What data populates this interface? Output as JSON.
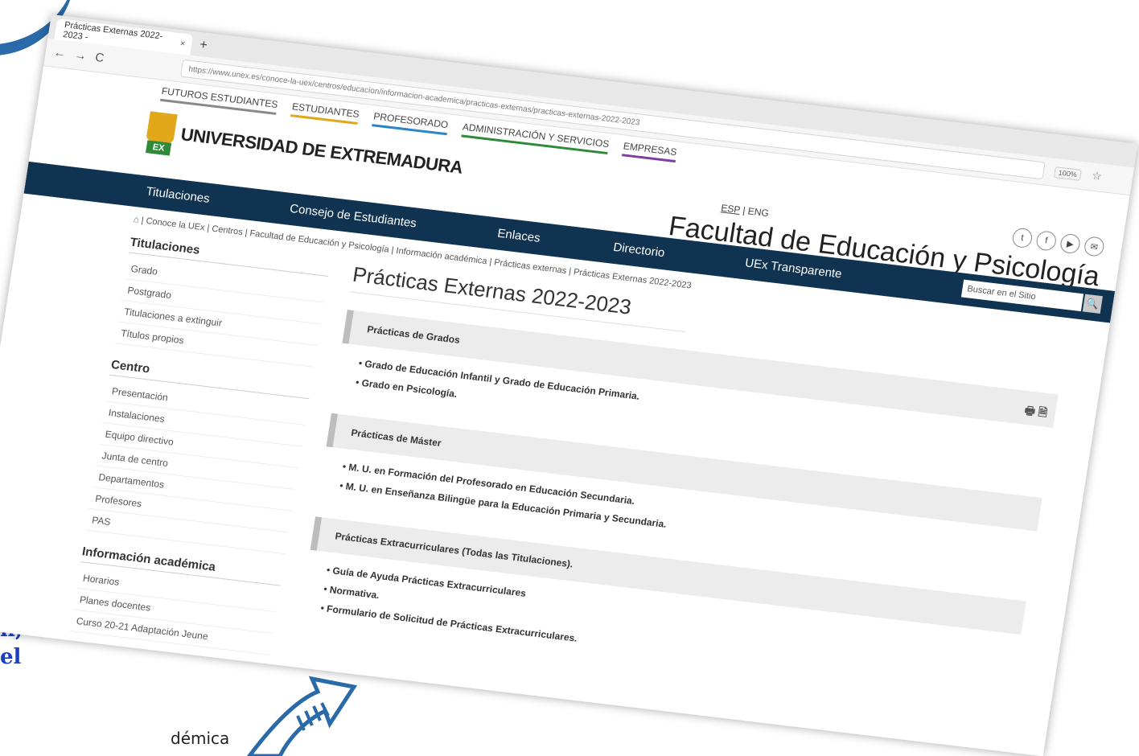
{
  "browser": {
    "tab_title": "Prácticas Externas 2022-2023 -",
    "tab_close": "×",
    "new_tab": "+",
    "back": "←",
    "forward": "→",
    "reload": "C",
    "url_text": "https://www.unex.es/conoce-la-uex/centros/educacion/informacion-academica/practicas-externas/practicas-externas-2022-2023",
    "zoom": "100%",
    "star": "☆"
  },
  "site": {
    "audience_nav": [
      "FUTUROS ESTUDIANTES",
      "ESTUDIANTES",
      "PROFESORADO",
      "ADMINISTRACIÓN Y SERVICIOS",
      "EMPRESAS"
    ],
    "audience_colors": [
      "#888888",
      "#e0a81a",
      "#2a86c8",
      "#2f8a3a",
      "#7b3fa0"
    ],
    "logo_ex": "EX",
    "logo_text": "UNIVERSIDAD DE EXTREMADURA",
    "lang_esp": "ESP",
    "lang_sep": "|",
    "lang_eng": "ENG",
    "social": [
      "t",
      "f",
      "▶",
      "✉"
    ],
    "faculty": "Facultad de Educación y Psicología",
    "main_nav": [
      "Titulaciones",
      "Consejo de Estudiantes",
      "Enlaces",
      "Directorio",
      "UEx Transparente"
    ],
    "search_placeholder": "Buscar en el Sitio",
    "search_button": "🔍",
    "nav_color": "#0f3350"
  },
  "breadcrumb": "⌂  |  Conoce la UEx  |  Centros  |  Facultad de Educación y Psicología  |  Información académica  |  Prácticas externas  |  Prácticas Externas 2022-2023",
  "sidebar": {
    "groups": [
      {
        "title": "Titulaciones",
        "items": [
          "Grado",
          "Postgrado",
          "Titulaciones a extinguir",
          "Títulos propios"
        ]
      },
      {
        "title": "Centro",
        "items": [
          "Presentación",
          "Instalaciones",
          "Equipo directivo",
          "Junta de centro",
          "Departamentos",
          "Profesores",
          "PAS"
        ]
      },
      {
        "title": "Información académica",
        "items": [
          "Horarios",
          "Planes docentes",
          "Curso 20-21 Adaptación Jeune"
        ]
      }
    ]
  },
  "content": {
    "title": "Prácticas Externas 2022-2023",
    "tools": "🖶 🗎",
    "sections": [
      {
        "title": "Prácticas de Grados",
        "items": [
          "Grado de Educación Infantil y Grado de Educación Primaria.",
          "Grado en Psicología."
        ]
      },
      {
        "title": "Prácticas de Máster",
        "items": [
          "M. U. en Formación del Profesorado en Educación Secundaria.",
          "M. U. en Enseñanza Bilingüe para la Educación Primaria y Secundaria."
        ]
      },
      {
        "title": "Prácticas Extracurriculares (Todas las Titulaciones).",
        "items": [
          "Guía de Ayuda Prácticas Extracurriculares",
          "Normativa.",
          "Formulario de Solicitud de Prácticas Extracurriculares."
        ]
      }
    ]
  },
  "slide": {
    "side_fragment_1": "el",
    "side_fragment_2": "n,",
    "side_fragment_3": "el",
    "bottom_text": "démica",
    "arrow_color": "#2a6aa8"
  }
}
